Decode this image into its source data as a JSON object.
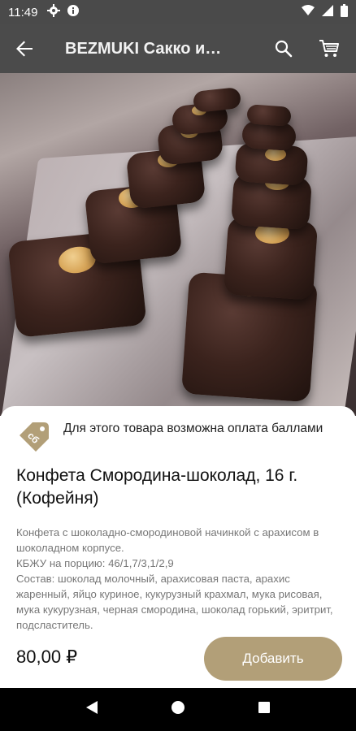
{
  "status_bar": {
    "time": "11:49",
    "left_icons": [
      "settings-icon",
      "info-icon"
    ],
    "right_icons": [
      "wifi-icon",
      "signal-icon",
      "battery-icon"
    ]
  },
  "app_bar": {
    "title": "BEZMUKI Сакко и…",
    "actions": [
      "search-icon",
      "cart-icon"
    ]
  },
  "product": {
    "bonus_note": "Для этого товара возможна оплата баллами",
    "title": "Конфета Смородина-шоколад, 16 г. (Кофейня)",
    "description": "Конфета с шоколадно-смородиновой начинкой с арахисом в шоколадном корпусе.\nКБЖУ на порцию: 46/1,7/3,1/2,9\nСостав: шоколад молочный, арахисовая паста, арахис жаренный, яйцо куриное, кукурузный крахмал, мука рисовая, мука кукурузная, черная смородина, шоколад горький, эритрит, подсластитель.",
    "price": "80,00 ₽",
    "add_label": "Добавить",
    "bonus_badge_text": "сб"
  },
  "colors": {
    "app_bar": "#4b4b4b",
    "accent": "#b29f78"
  }
}
